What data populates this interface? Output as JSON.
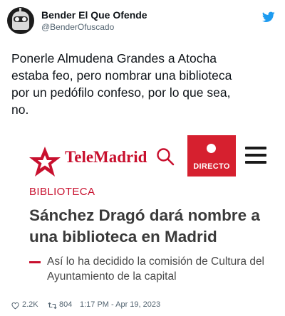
{
  "tweet": {
    "display_name": "Bender El Que Ofende",
    "handle": "@BenderOfuscado",
    "text": "Ponerle Almudena Grandes a Atocha\nestaba feo, pero nombrar una biblioteca\npor un pedófilo confeso, por lo que sea,\nno.",
    "likes": "2.2K",
    "retweets": "804",
    "timestamp": "1:17 PM - Apr 19, 2023"
  },
  "card": {
    "brand": "TeleMadrid",
    "live_label": "DIRECTO",
    "section": "BIBLIOTECA",
    "headline": "Sánchez Dragó dará nombre a una biblioteca en Madrid",
    "subhead": "Así lo ha decidido la comisión de Cultura del Ayuntamiento de la capital"
  },
  "colors": {
    "twitter_blue": "#1d9bf0",
    "telemadrid_red": "#c8102e",
    "live_red": "#d6202f"
  },
  "icons": [
    "avatar",
    "twitter-bird-icon",
    "telemadrid-star-logo",
    "search-icon",
    "live-dot-icon",
    "hamburger-menu-icon",
    "heart-icon",
    "retweet-icon"
  ]
}
